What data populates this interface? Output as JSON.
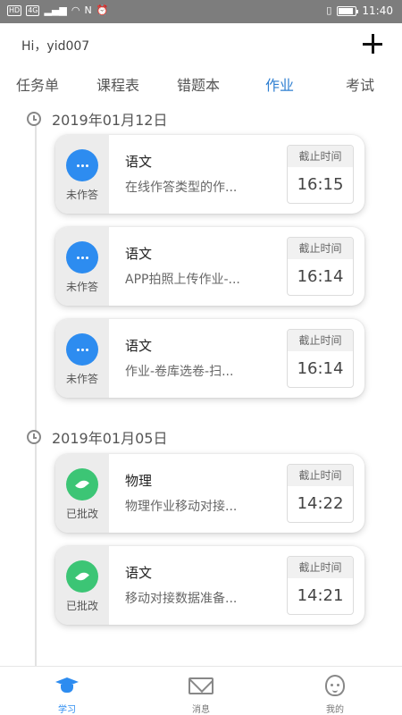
{
  "status_bar": {
    "left_chips": [
      "HD",
      "4G"
    ],
    "time": "11:40"
  },
  "header": {
    "greeting": "Hi，yid007",
    "add_icon": "plus-icon"
  },
  "tabs": [
    {
      "label": "任务单",
      "active": false
    },
    {
      "label": "课程表",
      "active": false
    },
    {
      "label": "错题本",
      "active": false
    },
    {
      "label": "作业",
      "active": true
    },
    {
      "label": "考试",
      "active": false
    }
  ],
  "groups": [
    {
      "date": "2019年01月12日",
      "cards": [
        {
          "status": "未作答",
          "status_icon": "more-dots-icon",
          "subject": "语文",
          "description": "在线作答类型的作...",
          "deadline_label": "截止时间",
          "deadline_time": "16:15"
        },
        {
          "status": "未作答",
          "status_icon": "more-dots-icon",
          "subject": "语文",
          "description": "APP拍照上传作业-...",
          "deadline_label": "截止时间",
          "deadline_time": "16:14"
        },
        {
          "status": "未作答",
          "status_icon": "more-dots-icon",
          "subject": "语文",
          "description": "作业-卷库选卷-扫...",
          "deadline_label": "截止时间",
          "deadline_time": "16:14"
        }
      ]
    },
    {
      "date": "2019年01月05日",
      "cards": [
        {
          "status": "已批改",
          "status_icon": "leaf-icon",
          "subject": "物理",
          "description": "物理作业移动对接...",
          "deadline_label": "截止时间",
          "deadline_time": "14:22"
        },
        {
          "status": "已批改",
          "status_icon": "leaf-icon",
          "subject": "语文",
          "description": "移动对接数据准备...",
          "deadline_label": "截止时间",
          "deadline_time": "14:21"
        }
      ]
    }
  ],
  "bottom_nav": [
    {
      "label": "学习",
      "icon": "graduation-cap-icon",
      "active": true
    },
    {
      "label": "消息",
      "icon": "envelope-icon",
      "active": false
    },
    {
      "label": "我的",
      "icon": "profile-face-icon",
      "active": false
    }
  ],
  "colors": {
    "accent": "#2f7fd1",
    "pending": "#2d8cf0",
    "graded": "#3cc575"
  }
}
